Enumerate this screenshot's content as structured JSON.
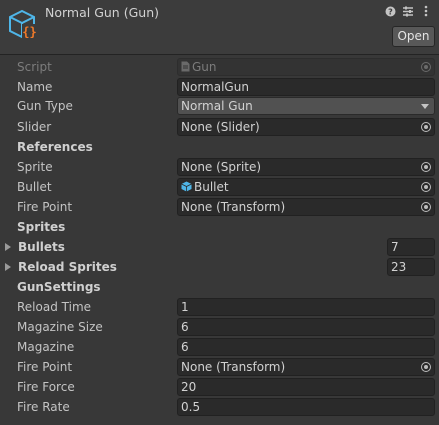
{
  "header": {
    "title": "Normal Gun (Gun)",
    "open_label": "Open",
    "icons": [
      "help-icon",
      "preset-icon",
      "more-icon"
    ]
  },
  "fields": {
    "script": {
      "label": "Script",
      "value": "Gun"
    },
    "name": {
      "label": "Name",
      "value": "NormalGun"
    },
    "gun_type": {
      "label": "Gun Type",
      "value": "Normal Gun"
    },
    "slider": {
      "label": "Slider",
      "value": "None (Slider)"
    }
  },
  "references": {
    "header": "References",
    "sprite": {
      "label": "Sprite",
      "value": "None (Sprite)"
    },
    "bullet": {
      "label": "Bullet",
      "value": "Bullet"
    },
    "fire_point": {
      "label": "Fire Point",
      "value": "None (Transform)"
    }
  },
  "sprites": {
    "header": "Sprites",
    "bullets": {
      "label": "Bullets",
      "value": "7"
    },
    "reload_sprites": {
      "label": "Reload Sprites",
      "value": "23"
    }
  },
  "gun_settings": {
    "header": "GunSettings",
    "reload_time": {
      "label": "Reload Time",
      "value": "1"
    },
    "magazine_size": {
      "label": "Magazine Size",
      "value": "6"
    },
    "magazine": {
      "label": "Magazine",
      "value": "6"
    },
    "fire_point": {
      "label": "Fire Point",
      "value": "None (Transform)"
    },
    "fire_force": {
      "label": "Fire Force",
      "value": "20"
    },
    "fire_rate": {
      "label": "Fire Rate",
      "value": "0.5"
    }
  },
  "colors": {
    "background": "#383838",
    "header_bg": "#3c3c3c",
    "field_bg": "#2a2a2a",
    "dropdown_bg": "#515151",
    "icon_blue": "#4fb6e8",
    "icon_orange": "#f07a2a"
  }
}
